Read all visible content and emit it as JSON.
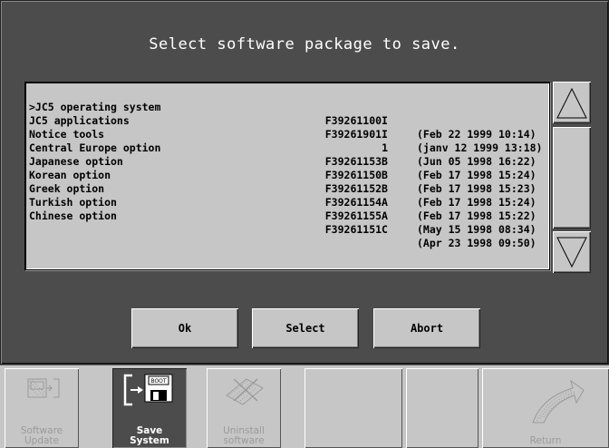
{
  "dialog": {
    "title": "Select software package to save.",
    "packages": [
      {
        "name": ">JC5 operating system",
        "code": "F39261100I",
        "date": "(Feb 22 1999 10:14)"
      },
      {
        "name": "JC5 applications",
        "code": "F39261901I",
        "date": "(janv 12 1999 13:18)"
      },
      {
        "name": "Notice tools",
        "code": "1",
        "date": "(Jun 05 1998 16:22)"
      },
      {
        "name": "Central Europe option",
        "code": "F39261153B",
        "date": "(Feb 17 1998 15:24)"
      },
      {
        "name": "Japanese option",
        "code": "F39261150B",
        "date": "(Feb 17 1998 15:23)"
      },
      {
        "name": "Korean option",
        "code": "F39261152B",
        "date": "(Feb 17 1998 15:24)"
      },
      {
        "name": "Greek option",
        "code": "F39261154A",
        "date": "(Feb 17 1998 15:22)"
      },
      {
        "name": "Turkish option",
        "code": "F39261155A",
        "date": "(May 15 1998 08:34)"
      },
      {
        "name": "Chinese option",
        "code": "F39261151C",
        "date": "(Apr 23 1998 09:50)"
      }
    ],
    "buttons": {
      "ok": "Ok",
      "select": "Select",
      "abort": "Abort"
    }
  },
  "toolbar": {
    "items": [
      {
        "label_line1": "Software",
        "label_line2": "Update",
        "icon": "software-update-icon",
        "state": "disabled"
      },
      {
        "label_line1": "Save",
        "label_line2": "System",
        "icon": "save-system-icon",
        "state": "active"
      },
      {
        "label_line1": "Uninstall",
        "label_line2": "software",
        "icon": "uninstall-software-icon",
        "state": "disabled"
      },
      {
        "label_line1": "",
        "label_line2": "",
        "icon": "",
        "state": "empty"
      },
      {
        "label_line1": "",
        "label_line2": "",
        "icon": "",
        "state": "empty"
      },
      {
        "label_line1": "",
        "label_line2": "Return",
        "icon": "return-arrow-icon",
        "state": "disabled"
      }
    ]
  },
  "colors": {
    "dialog_bg": "#4c4c4c",
    "panel_bg": "#c6c6c6",
    "text": "#000000",
    "title": "#ffffff"
  }
}
